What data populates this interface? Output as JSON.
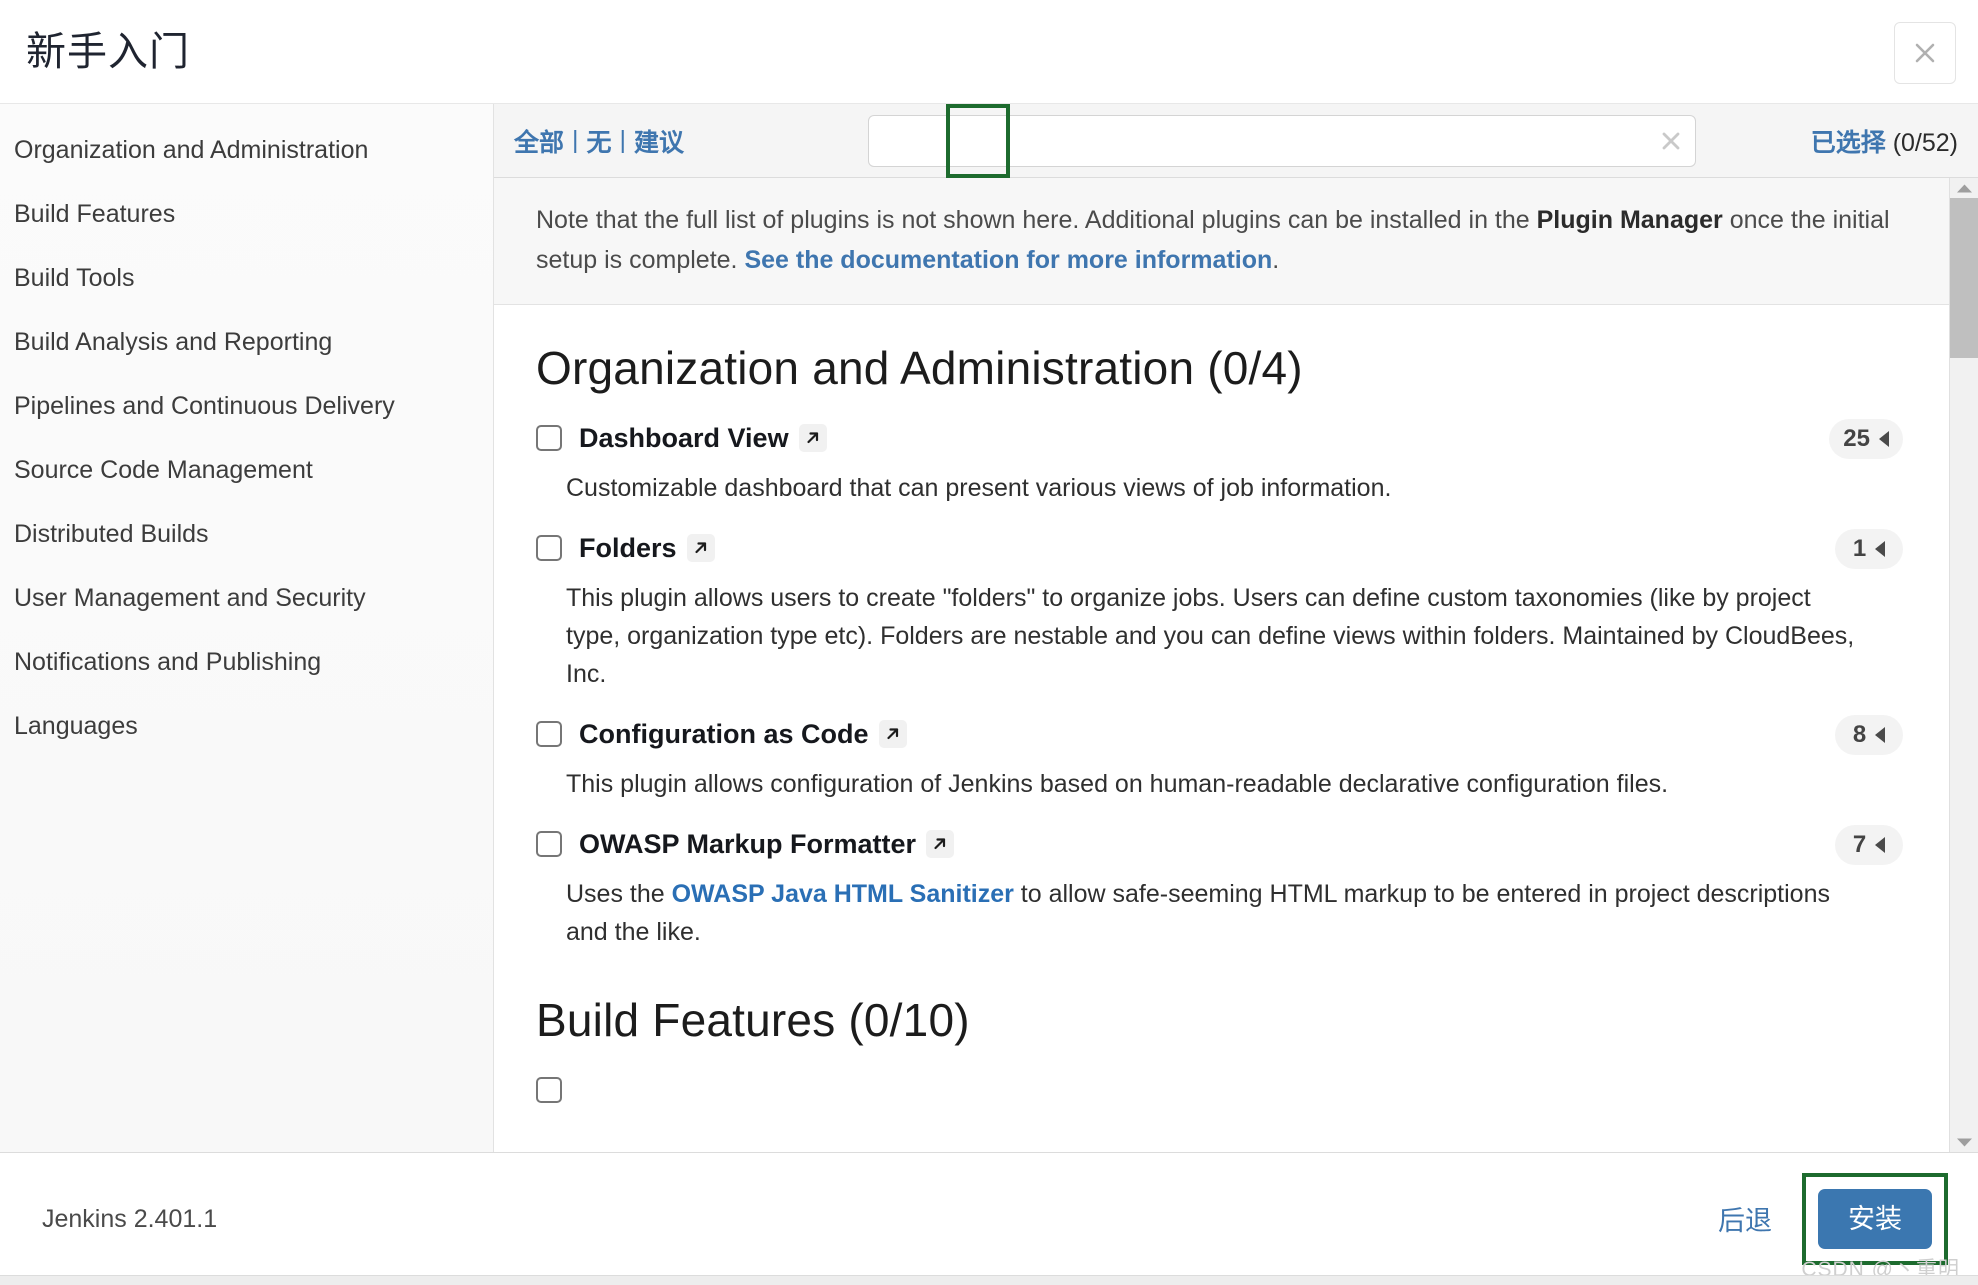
{
  "header": {
    "title": "新手入门",
    "close_icon": "close-icon"
  },
  "sidebar": {
    "items": [
      {
        "label": "Organization and Administration"
      },
      {
        "label": "Build Features"
      },
      {
        "label": "Build Tools"
      },
      {
        "label": "Build Analysis and Reporting"
      },
      {
        "label": "Pipelines and Continuous Delivery"
      },
      {
        "label": "Source Code Management"
      },
      {
        "label": "Distributed Builds"
      },
      {
        "label": "User Management and Security"
      },
      {
        "label": "Notifications and Publishing"
      },
      {
        "label": "Languages"
      }
    ]
  },
  "filterbar": {
    "all_label": "全部",
    "none_label": "无",
    "suggested_label": "建议",
    "separator": "|",
    "search_value": "",
    "search_placeholder": "",
    "clear_icon": "close-icon",
    "selected_label": "已选择",
    "selected_count": "(0/52)"
  },
  "note": {
    "part1": "Note that the full list of plugins is not shown here. Additional plugins can be installed in the ",
    "bold": "Plugin Manager",
    "part2": " once the initial setup is complete. ",
    "link": "See the documentation for more information",
    "part3": "."
  },
  "sections": [
    {
      "title": "Organization and Administration (0/4)",
      "plugins": [
        {
          "name": "Dashboard View",
          "link_icon": "external-link-icon",
          "desc": "Customizable dashboard that can present various views of job information.",
          "dep_count": "25"
        },
        {
          "name": "Folders",
          "link_icon": "external-link-icon",
          "desc": "This plugin allows users to create \"folders\" to organize jobs. Users can define custom taxonomies (like by project type, organization type etc). Folders are nestable and you can define views within folders. Maintained by CloudBees, Inc.",
          "dep_count": "1"
        },
        {
          "name": "Configuration as Code",
          "link_icon": "external-link-icon",
          "desc": "This plugin allows configuration of Jenkins based on human-readable declarative configuration files.",
          "dep_count": "8"
        },
        {
          "name": "OWASP Markup Formatter",
          "link_icon": "external-link-icon",
          "desc_part1": "Uses the ",
          "desc_link": "OWASP Java HTML Sanitizer",
          "desc_part2": " to allow safe-seeming HTML markup to be entered in project descriptions and the like.",
          "dep_count": "7"
        }
      ]
    },
    {
      "title": "Build Features (0/10)",
      "plugins": []
    }
  ],
  "footer": {
    "version": "Jenkins 2.401.1",
    "back_label": "后退",
    "install_label": "安装",
    "watermark": "CSDN @丶重明"
  },
  "colors": {
    "link_blue": "#3f76af",
    "install_blue": "#3b77b0",
    "highlight_green": "#1d6b2e",
    "sidebar_bg": "#fafafa"
  }
}
